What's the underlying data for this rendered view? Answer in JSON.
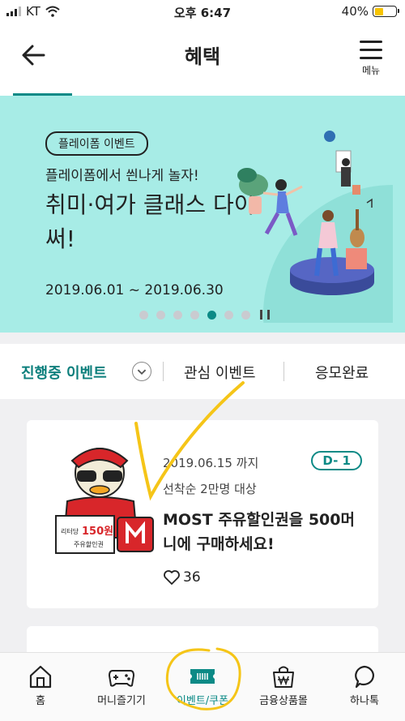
{
  "status_bar": {
    "carrier": "KT",
    "time": "오후 6:47",
    "battery": "40%",
    "battery_level": 0.4
  },
  "header": {
    "title": "혜택",
    "menu_label": "메뉴"
  },
  "banner": {
    "tag": "플레이폼 이벤트",
    "subtitle": "플레이폼에서 씐나게 놀자!",
    "headline": "취미·여가 클래스 다이써!",
    "dates": "2019.06.01 ~ 2019.06.30",
    "slide_count": 7,
    "active_slide": 5
  },
  "tabs": {
    "ongoing": "진행중 이벤트",
    "interest": "관심 이벤트",
    "completed": "응모완료"
  },
  "event_card": {
    "thumb_price": "150원",
    "thumb_caption_prefix": "리터당",
    "thumb_caption": "주유할인권",
    "deadline": "2019.06.15 까지",
    "dday": "D- 1",
    "target": "선착순 2만명 대상",
    "title": "MOST 주유할인권을 500머니에 구매하세요!",
    "likes": "36"
  },
  "bottom_nav": {
    "home": "홈",
    "money_fun": "머니즐기기",
    "events_coupons": "이벤트/쿠폰",
    "financial_mall": "금융상품몰",
    "hana_talk": "하나톡"
  },
  "colors": {
    "accent": "#0c8a86",
    "banner_bg": "#a7ece6",
    "highlight": "#f5c518"
  }
}
